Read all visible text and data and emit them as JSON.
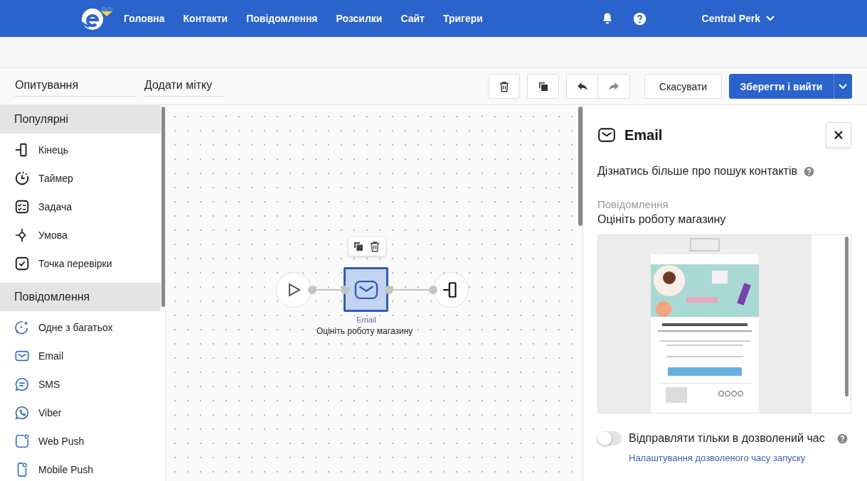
{
  "topbar": {
    "nav": [
      {
        "label": "Головна"
      },
      {
        "label": "Контакти"
      },
      {
        "label": "Повідомлення"
      },
      {
        "label": "Розсилки"
      },
      {
        "label": "Сайт"
      },
      {
        "label": "Тригери"
      }
    ],
    "account": "Central Perk"
  },
  "toolbar": {
    "name_field": {
      "value": "Опитування"
    },
    "tag_field": {
      "placeholder": "Додати мітку"
    },
    "cancel": "Скасувати",
    "save": "Зберегти і вийти"
  },
  "sidebar": {
    "sections": [
      {
        "title": "Популярні",
        "items": [
          {
            "label": "Кінець"
          },
          {
            "label": "Таймер"
          },
          {
            "label": "Задача"
          },
          {
            "label": "Умова"
          },
          {
            "label": "Точка перевірки"
          }
        ]
      },
      {
        "title": "Повідомлення",
        "items": [
          {
            "label": "Одне з багатьох"
          },
          {
            "label": "Email"
          },
          {
            "label": "SMS"
          },
          {
            "label": "Viber"
          },
          {
            "label": "Web Push"
          },
          {
            "label": "Mobile Push"
          }
        ]
      }
    ]
  },
  "canvas": {
    "nodes": [
      {
        "kind": "start",
        "selected": false
      },
      {
        "kind": "email",
        "type_label": "Email",
        "caption": "Оцініть роботу магазину",
        "selected": true
      },
      {
        "kind": "end",
        "selected": false
      }
    ]
  },
  "panel": {
    "title": "Email",
    "help_text": "Дізнатись більше про пошук контактів",
    "message_label": "Повідомлення",
    "message_value": "Оцініть роботу магазину",
    "toggle": {
      "label": "Відправляти тільки в дозволений час",
      "on": false
    },
    "link": "Налаштування дозволеного часу запуску"
  }
}
